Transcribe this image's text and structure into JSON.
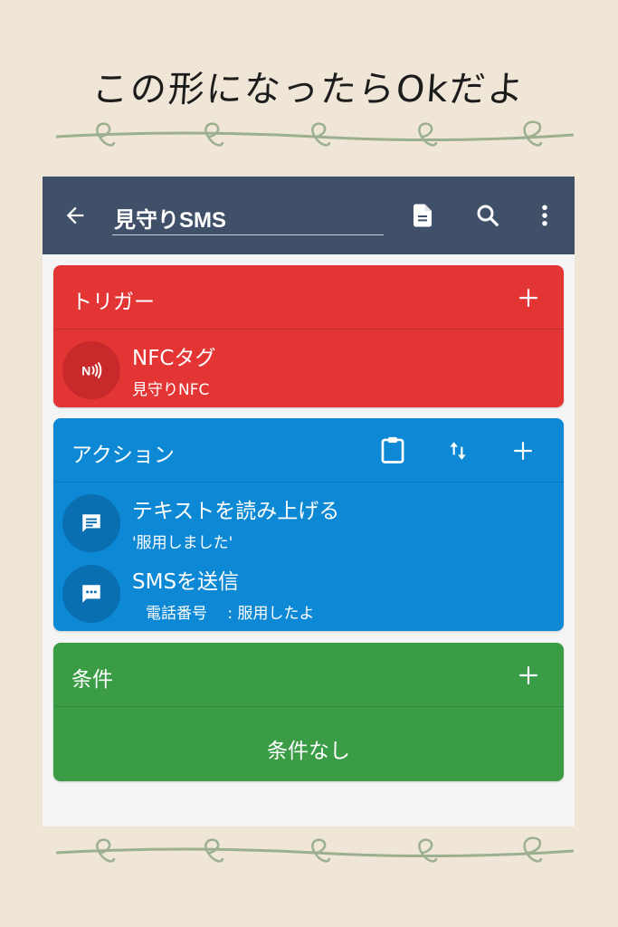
{
  "headline": "この形になったらOkだよ",
  "colors": {
    "appbar": "#3f5068",
    "trigger": "#e23534",
    "action": "#0c88d5",
    "condition": "#3a9c45",
    "background": "#efe6d8",
    "vine": "#9caf8e"
  },
  "appbar": {
    "back_icon": "arrow-left-icon",
    "title": "見守りSMS",
    "icons": [
      "document-icon",
      "search-icon",
      "more-vert-icon"
    ]
  },
  "trigger_section": {
    "title": "トリガー",
    "add_icon": "plus-icon",
    "items": [
      {
        "icon": "nfc-icon",
        "title": "NFCタグ",
        "subtitle": "見守りNFC"
      }
    ]
  },
  "action_section": {
    "title": "アクション",
    "icons": [
      "clipboard-icon",
      "swap-vert-icon",
      "plus-icon"
    ],
    "items": [
      {
        "icon": "message-icon",
        "title": "テキストを読み上げる",
        "subtitle": "'服用しました'"
      },
      {
        "icon": "sms-icon",
        "title": "SMSを送信",
        "subtitle": "電話番号　 : 服用したよ"
      }
    ]
  },
  "condition_section": {
    "title": "条件",
    "add_icon": "plus-icon",
    "empty_text": "条件なし"
  }
}
